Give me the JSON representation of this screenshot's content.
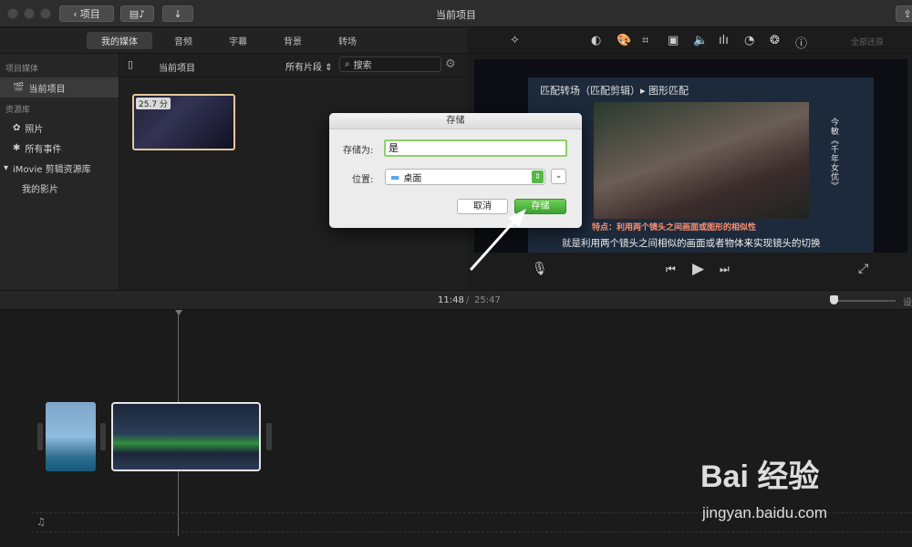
{
  "window": {
    "title": "当前项目",
    "back_label": "项目"
  },
  "browser": {
    "tabs": [
      {
        "label": "我的媒体",
        "active": true
      },
      {
        "label": "音频",
        "active": false
      },
      {
        "label": "字幕",
        "active": false
      },
      {
        "label": "背景",
        "active": false
      },
      {
        "label": "转场",
        "active": false
      }
    ]
  },
  "library": {
    "project_media_heading": "项目媒体",
    "current_project": "当前项目",
    "libraries_heading": "资源库",
    "photos": "照片",
    "all_events": "所有事件",
    "imovie_library": "iMovie 剪辑资源库",
    "my_movie": "我的影片"
  },
  "media": {
    "breadcrumb": "当前项目",
    "filter": "所有片段",
    "search_placeholder": "搜索",
    "clip_duration": "25.7 分"
  },
  "viewer": {
    "top_right": "全部还原",
    "video_title": "匹配转场（匹配剪辑）▸ 图形匹配",
    "video_side_text": "今敏《千年女优》",
    "video_red_text": "特点：利用两个镜头之间画面或图形的相似性",
    "video_subtitle": "就是利用两个镜头之间相似的画面或者物体来实现镜头的切换"
  },
  "timeline": {
    "current_time": "11:48",
    "separator": "/",
    "total_time": "25:47",
    "settings_label": "设"
  },
  "dialog": {
    "title": "存储",
    "save_as_label": "存储为:",
    "save_as_value": "是",
    "location_label": "位置:",
    "location_value": "桌面",
    "cancel_label": "取消",
    "save_label": "存储"
  },
  "watermark": {
    "brand": "Bai 经验",
    "url": "jingyan.baidu.com"
  }
}
